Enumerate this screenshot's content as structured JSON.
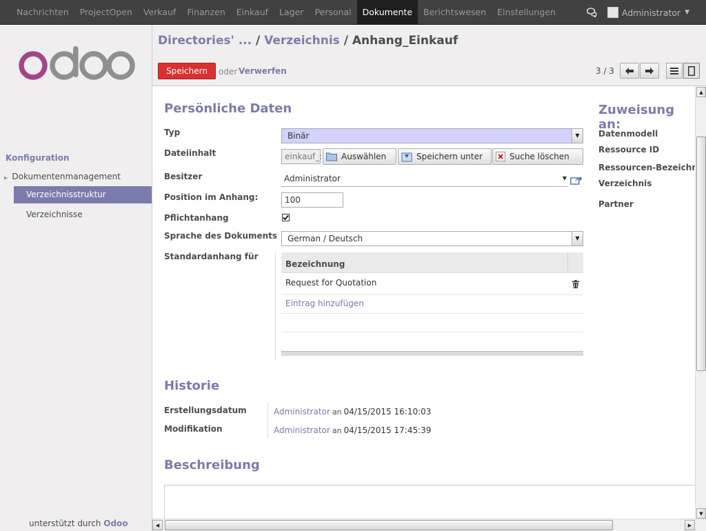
{
  "topnav": {
    "items": [
      "Nachrichten",
      "ProjectOpen",
      "Verkauf",
      "Finanzen",
      "Einkauf",
      "Lager",
      "Personal",
      "Dokumente",
      "Berichtswesen",
      "Einstellungen"
    ],
    "active": "Dokumente",
    "user": "Administrator",
    "chat_icon": "chat-bubbles-icon"
  },
  "sidebar": {
    "logo_text": "odoo",
    "section_title": "Konfiguration",
    "parent_item": "Dokumentenmanagement",
    "items": [
      {
        "label": "Verzeichnisstruktur",
        "active": true
      },
      {
        "label": "Verzeichnisse",
        "active": false
      }
    ],
    "footer_prefix": "unterstützt durch",
    "footer_brand": "Odoo"
  },
  "control": {
    "breadcrumb": [
      "Directories' ...",
      "Verzeichnis",
      "Anhang_Einkauf"
    ],
    "save_label": "Speichern",
    "or_label": "oder",
    "discard_label": "Verwerfen",
    "pager": "3 / 3"
  },
  "form": {
    "section_personal": "Persönliche Daten",
    "fields": {
      "typ_label": "Typ",
      "typ_value": "Binär",
      "file_label": "Dateiinhalt",
      "file_value": "einkauf_:",
      "select_btn": "Auswählen",
      "saveas_btn": "Speichern unter",
      "clear_btn": "Suche löschen",
      "owner_label": "Besitzer",
      "owner_value": "Administrator",
      "position_label": "Position im Anhang:",
      "position_value": "100",
      "required_label": "Pflichtanhang",
      "required_checked": true,
      "language_label": "Sprache des Dokuments",
      "language_value": "German / Deutsch",
      "default_for_label": "Standardanhang für"
    },
    "o2m": {
      "header": "Bezeichnung",
      "rows": [
        "Request for Quotation"
      ],
      "add_label": "Eintrag hinzufügen"
    },
    "section_assign": "Zuweisung an:",
    "assign_labels": [
      "Datenmodell",
      "Ressource ID",
      "Ressourcen-Bezeichnu",
      "Verzeichnis",
      "Partner"
    ],
    "section_history": "Historie",
    "history": {
      "created_label": "Erstellungsdatum",
      "created_by": "Administrator",
      "created_an": "an",
      "created_at": "04/15/2015 16:10:03",
      "modified_label": "Modifikation",
      "modified_by": "Administrator",
      "modified_an": "an",
      "modified_at": "04/15/2015 17:45:39"
    },
    "section_description": "Beschreibung"
  }
}
